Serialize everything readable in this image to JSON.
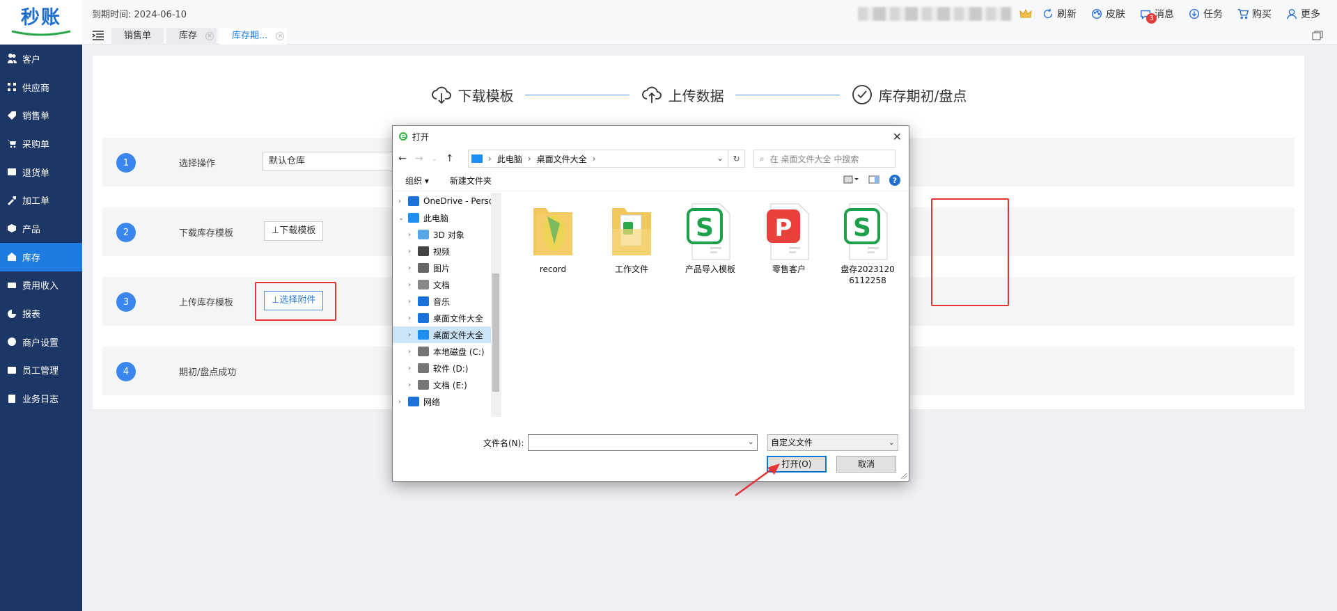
{
  "app": {
    "logo": "秒账"
  },
  "topbar": {
    "expire_label": "到期时间: 2024-06-10",
    "actions": [
      {
        "label": "刷新",
        "icon": "refresh-icon"
      },
      {
        "label": "皮肤",
        "icon": "palette-icon"
      },
      {
        "label": "消息",
        "icon": "message-icon",
        "badge": "3"
      },
      {
        "label": "任务",
        "icon": "task-download-icon"
      },
      {
        "label": "购买",
        "icon": "cart-icon"
      },
      {
        "label": "更多",
        "icon": "user-icon"
      }
    ]
  },
  "tabs": [
    {
      "label": "销售单"
    },
    {
      "label": "库存"
    },
    {
      "label": "库存期..."
    }
  ],
  "sidebar": {
    "items": [
      {
        "label": "客户",
        "icon": "users-icon"
      },
      {
        "label": "供应商",
        "icon": "supplier-icon"
      },
      {
        "label": "销售单",
        "icon": "tag-icon"
      },
      {
        "label": "采购单",
        "icon": "cart-icon"
      },
      {
        "label": "退货单",
        "icon": "return-icon"
      },
      {
        "label": "加工单",
        "icon": "tools-icon"
      },
      {
        "label": "产品",
        "icon": "box-icon"
      },
      {
        "label": "库存",
        "icon": "warehouse-icon"
      },
      {
        "label": "费用收入",
        "icon": "money-icon"
      },
      {
        "label": "报表",
        "icon": "pie-icon"
      },
      {
        "label": "商户设置",
        "icon": "gear-icon"
      },
      {
        "label": "员工管理",
        "icon": "id-card-icon"
      },
      {
        "label": "业务日志",
        "icon": "log-icon"
      }
    ]
  },
  "steps_header": [
    {
      "label": "下载模板",
      "icon": "cloud-download-icon"
    },
    {
      "label": "上传数据",
      "icon": "cloud-upload-icon"
    },
    {
      "label": "库存期初/盘点",
      "icon": "check-circle-icon"
    }
  ],
  "rows": [
    {
      "num": "1",
      "label": "选择操作",
      "control": "默认仓库"
    },
    {
      "num": "2",
      "label": "下载库存模板",
      "control": "⊥下载模板"
    },
    {
      "num": "3",
      "label": "上传库存模板",
      "control": "⊥选择附件"
    },
    {
      "num": "4",
      "label": "期初/盘点成功",
      "control": ""
    }
  ],
  "dialog": {
    "title": "打开",
    "breadcrumb": [
      "此电脑",
      "桌面文件大全"
    ],
    "search_placeholder": "在 桌面文件大全 中搜索",
    "toolbar": {
      "organize": "组织 ▾",
      "new_folder": "新建文件夹"
    },
    "tree": [
      {
        "label": "OneDrive - Perso",
        "level": 0,
        "icon": "onedrive-icon"
      },
      {
        "label": "此电脑",
        "level": 0,
        "icon": "pc-icon",
        "expanded": true
      },
      {
        "label": "3D 对象",
        "level": 1,
        "icon": "3d-icon"
      },
      {
        "label": "视频",
        "level": 1,
        "icon": "video-icon"
      },
      {
        "label": "图片",
        "level": 1,
        "icon": "picture-icon"
      },
      {
        "label": "文档",
        "level": 1,
        "icon": "document-icon"
      },
      {
        "label": "音乐",
        "level": 1,
        "icon": "music-icon"
      },
      {
        "label": "桌面文件大全",
        "level": 1,
        "icon": "download-icon"
      },
      {
        "label": "桌面文件大全",
        "level": 1,
        "icon": "desktop-icon",
        "selected": true
      },
      {
        "label": "本地磁盘 (C:)",
        "level": 1,
        "icon": "disk-icon"
      },
      {
        "label": "软件 (D:)",
        "level": 1,
        "icon": "disk-icon"
      },
      {
        "label": "文档 (E:)",
        "level": 1,
        "icon": "disk-icon"
      },
      {
        "label": "网络",
        "level": 0,
        "icon": "network-icon"
      }
    ],
    "files": [
      {
        "name": "record",
        "type": "folder-image"
      },
      {
        "name": "工作文件",
        "type": "folder-sheet"
      },
      {
        "name": "产品导入模板",
        "type": "wps-sheet"
      },
      {
        "name": "零售客户",
        "type": "wps-ppt"
      },
      {
        "name": "盘存20231206112258",
        "type": "wps-sheet",
        "highlighted": true
      }
    ],
    "filename_label": "文件名(N):",
    "filename_value": "",
    "filetype": "自定义文件",
    "open_btn": "打开(O)",
    "cancel_btn": "取消"
  },
  "colors": {
    "sidebar_bg": "#1c3666",
    "active_blue": "#1e7be0",
    "annotation_red": "#e53333"
  }
}
